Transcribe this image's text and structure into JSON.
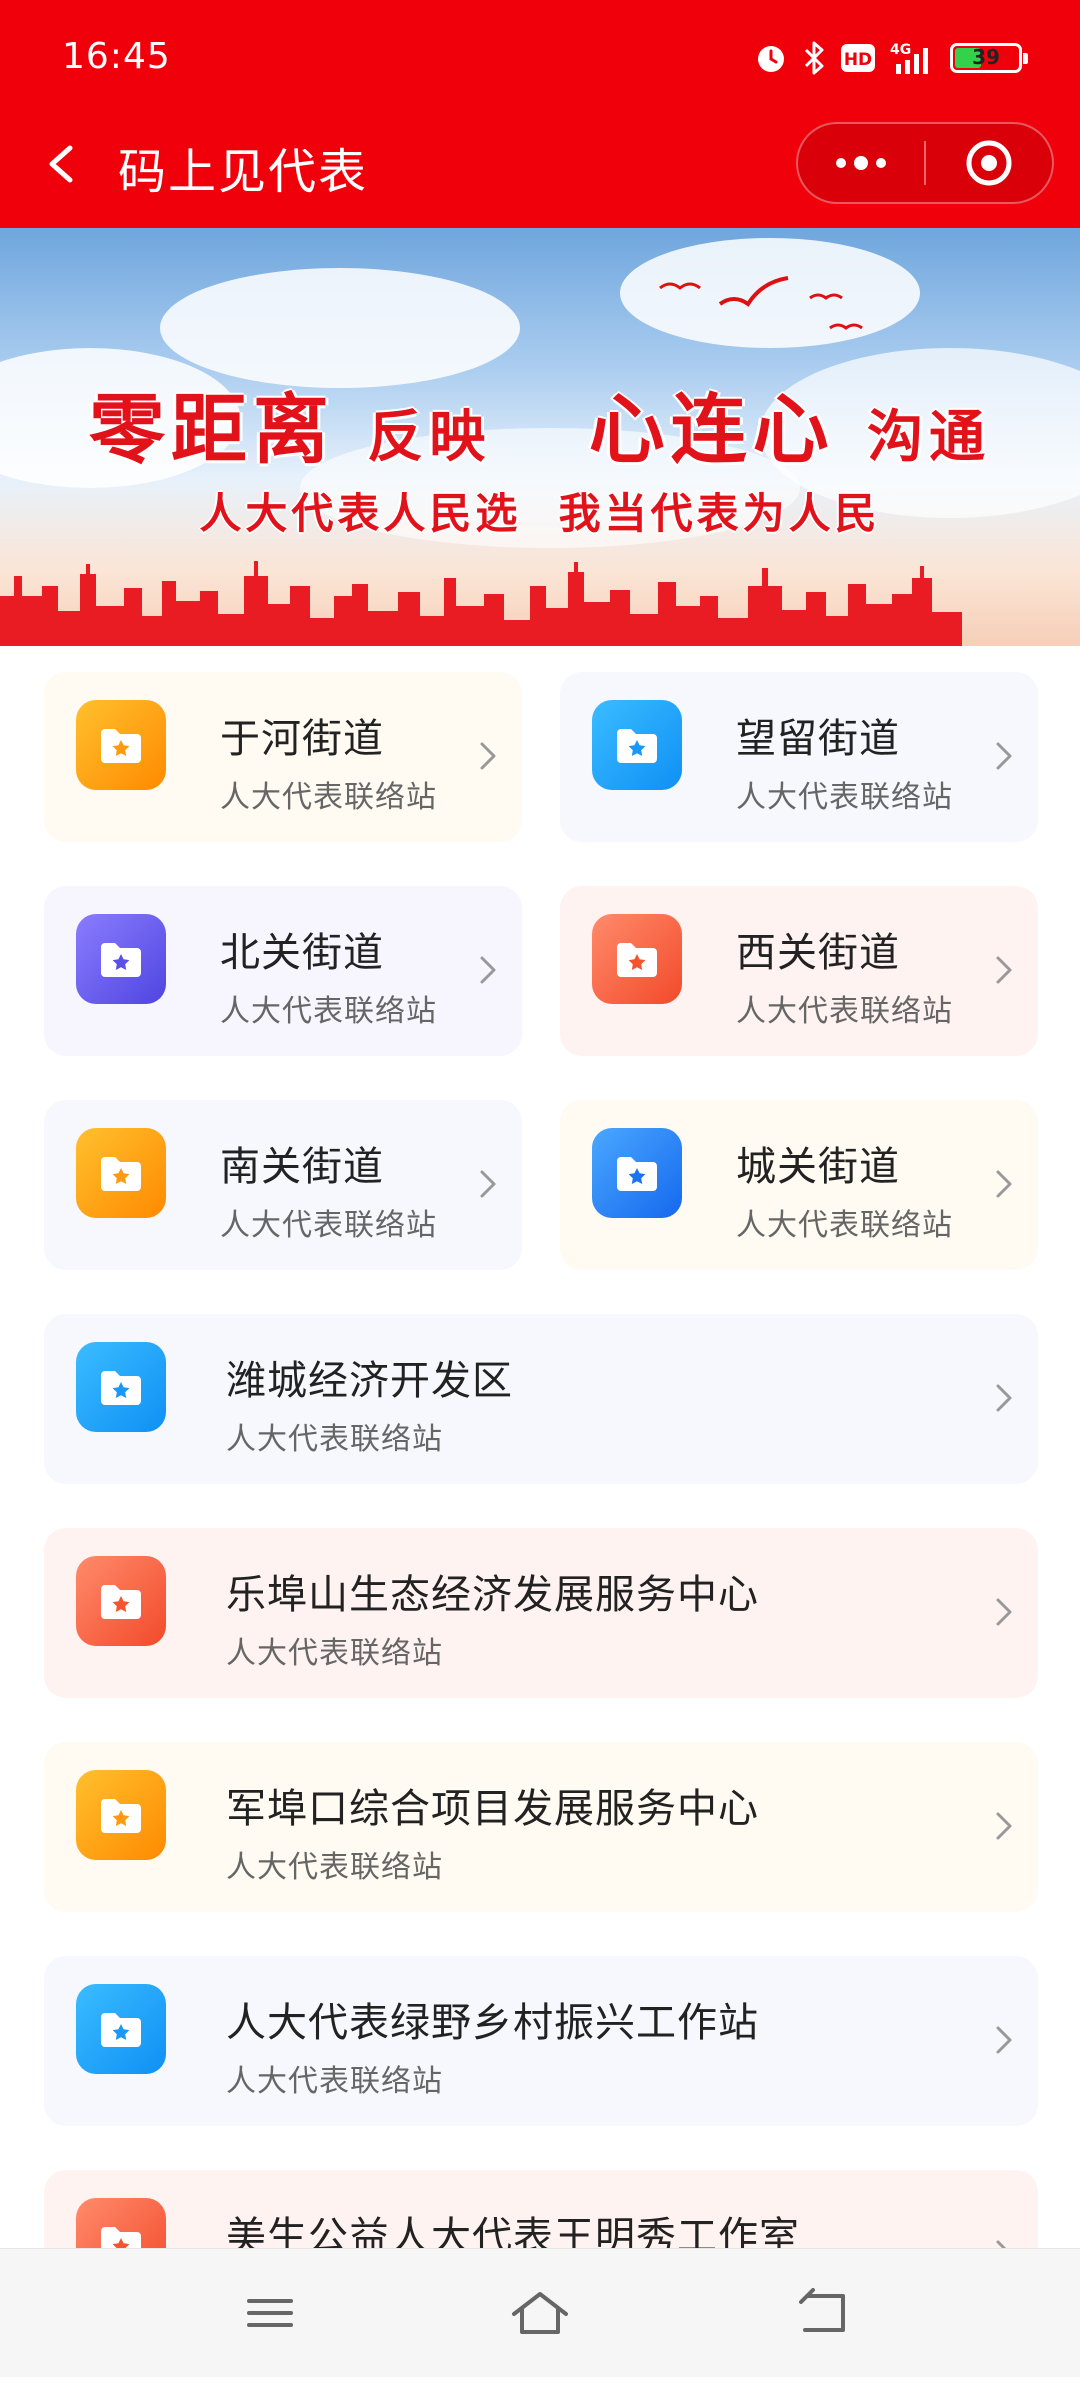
{
  "status": {
    "time": "16:45",
    "battery": "39",
    "network": "4G"
  },
  "nav": {
    "title": "码上见代表"
  },
  "banner": {
    "line1_a": "零距离",
    "line1_b": "反映",
    "line1_c": "心连心",
    "line1_d": "沟通",
    "line2": "人大代表人民选  我当代表为人民"
  },
  "colors": {
    "header": "#f0000b"
  },
  "stations": [
    {
      "name": "于河街道",
      "sub": "人大代表联络站",
      "color": "orange"
    },
    {
      "name": "望留街道",
      "sub": "人大代表联络站",
      "color": "blue"
    },
    {
      "name": "北关街道",
      "sub": "人大代表联络站",
      "color": "purple"
    },
    {
      "name": "西关街道",
      "sub": "人大代表联络站",
      "color": "red"
    },
    {
      "name": "南关街道",
      "sub": "人大代表联络站",
      "color": "orange"
    },
    {
      "name": "城关街道",
      "sub": "人大代表联络站",
      "color": "blue"
    },
    {
      "name": "潍城经济开发区",
      "sub": "人大代表联络站",
      "color": "blue"
    },
    {
      "name": "乐埠山生态经济发展服务中心",
      "sub": "人大代表联络站",
      "color": "red"
    },
    {
      "name": "军埠口综合项目发展服务中心",
      "sub": "人大代表联络站",
      "color": "orange"
    },
    {
      "name": "人大代表绿野乡村振兴工作站",
      "sub": "人大代表联络站",
      "color": "blue"
    },
    {
      "name": "美生公益人大代表王明秀工作室",
      "sub": "",
      "color": "red"
    }
  ],
  "icons": [
    "folder-star-icon",
    "chevron-right-icon",
    "back-arrow-icon",
    "more-icon",
    "target-icon",
    "menu-icon",
    "home-icon",
    "return-icon"
  ]
}
